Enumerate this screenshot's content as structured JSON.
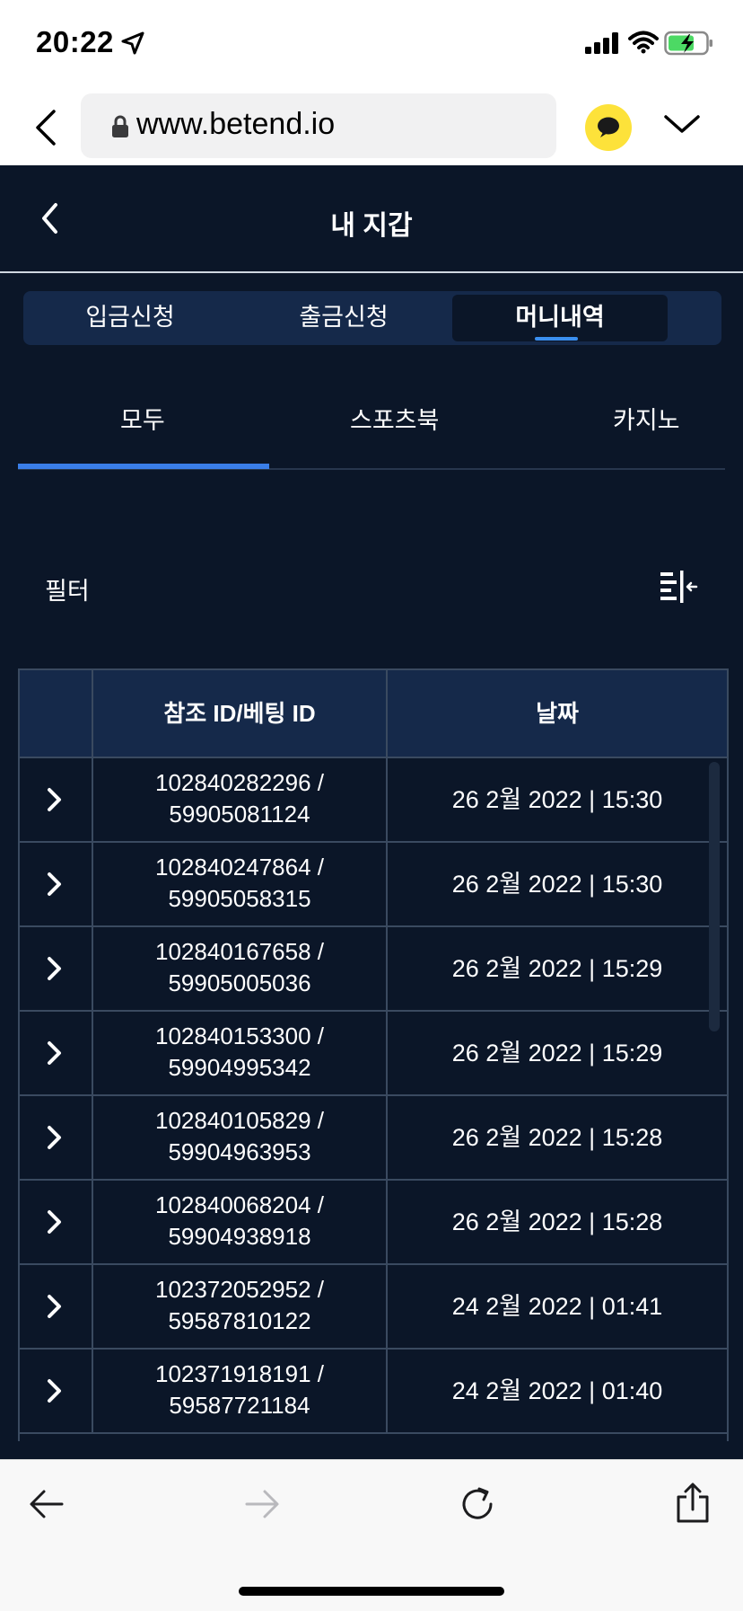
{
  "status_bar": {
    "time": "20:22"
  },
  "browser": {
    "url": "www.betend.io"
  },
  "header": {
    "title": "내 지갑"
  },
  "wallet_tabs": [
    {
      "label": "입금신청",
      "active": false
    },
    {
      "label": "출금신청",
      "active": false
    },
    {
      "label": "머니내역",
      "active": true
    }
  ],
  "category_tabs": [
    {
      "label": "모두",
      "active": true
    },
    {
      "label": "스포츠북",
      "active": false
    },
    {
      "label": "카지노",
      "active": false
    }
  ],
  "filter": {
    "label": "필터"
  },
  "table": {
    "headers": {
      "ref": "참조 ID/베팅 ID",
      "date": "날짜"
    },
    "rows": [
      {
        "ref_id": "102840282296 /",
        "bet_id": "59905081124",
        "date": "26 2월 2022 | 15:30"
      },
      {
        "ref_id": "102840247864 /",
        "bet_id": "59905058315",
        "date": "26 2월 2022 | 15:30"
      },
      {
        "ref_id": "102840167658 /",
        "bet_id": "59905005036",
        "date": "26 2월 2022 | 15:29"
      },
      {
        "ref_id": "102840153300 /",
        "bet_id": "59904995342",
        "date": "26 2월 2022 | 15:29"
      },
      {
        "ref_id": "102840105829 /",
        "bet_id": "59904963953",
        "date": "26 2월 2022 | 15:28"
      },
      {
        "ref_id": "102840068204 /",
        "bet_id": "59904938918",
        "date": "26 2월 2022 | 15:28"
      },
      {
        "ref_id": "102372052952 /",
        "bet_id": "59587810122",
        "date": "24 2월 2022 | 01:41"
      },
      {
        "ref_id": "102371918191 /",
        "bet_id": "59587721184",
        "date": "24 2월 2022 | 01:40"
      }
    ]
  },
  "colors": {
    "background": "#0b1628",
    "panel": "#15294a",
    "accent": "#3a7ee8",
    "chat_button": "#fde23a"
  },
  "icons": [
    "location-arrow-icon",
    "signal-icon",
    "wifi-icon",
    "battery-charging-icon",
    "lock-icon",
    "chat-bubble-icon",
    "chevron-down-icon",
    "back-chevron-icon",
    "filter-icon",
    "expand-chevron-icon",
    "arrow-left-icon",
    "arrow-right-icon",
    "reload-icon",
    "share-icon"
  ]
}
